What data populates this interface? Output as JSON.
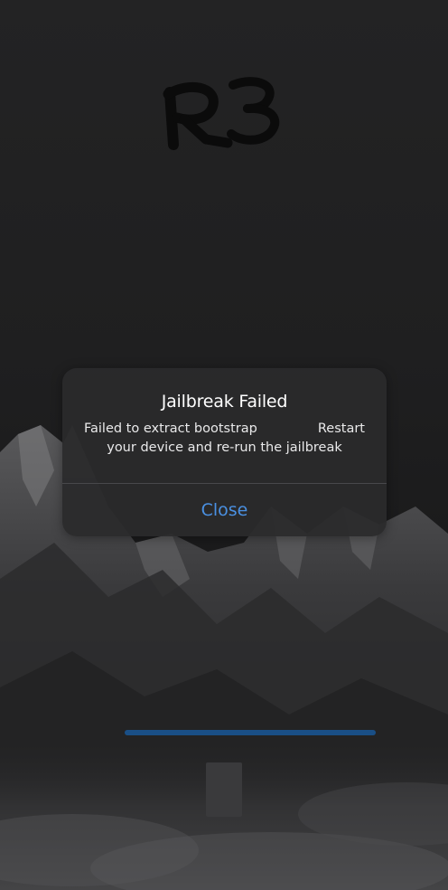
{
  "logo": {
    "text": "R3"
  },
  "dialog": {
    "title": "Jailbreak Failed",
    "message_part1": "Failed to extract bootstrap",
    "message_part2": "Restart",
    "message_line2": "your device and re-run the jailbreak",
    "close_label": "Close"
  },
  "progress": {
    "fraction": 1.0
  },
  "colors": {
    "accent": "#4a90e2",
    "progress": "#1a4f86",
    "dialog_bg": "#2a2a2c"
  }
}
